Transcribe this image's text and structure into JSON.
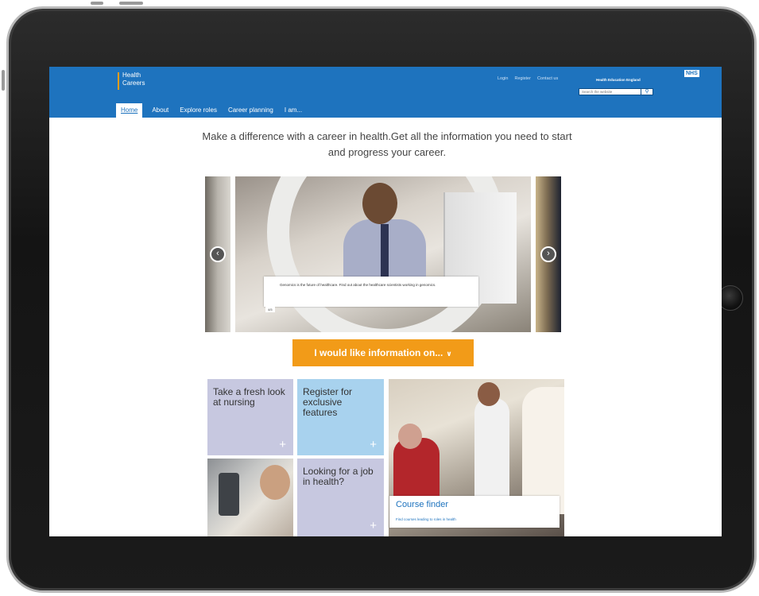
{
  "device": {
    "type": "tablet",
    "frame_color": "#1b1b1b"
  },
  "header": {
    "bg_color": "#1e73be",
    "logo": {
      "line1": "Health",
      "line2": "Careers"
    },
    "utility_links": [
      "Login",
      "Register",
      "Contact us"
    ],
    "nhs_badge": "NHS",
    "org_name": "Health Education England",
    "search": {
      "placeholder": "Search the website"
    }
  },
  "nav": {
    "items": [
      {
        "label": "Home",
        "active": true
      },
      {
        "label": "About"
      },
      {
        "label": "Explore roles"
      },
      {
        "label": "Career planning"
      },
      {
        "label": "I am..."
      }
    ]
  },
  "tagline": "Make a difference with a career in health.Get all the information you need to start and progress your career.",
  "carousel": {
    "caption": "Genomics is the future of healthcare. Find out about the healthcare scientists working in genomics.",
    "counter": "4/5",
    "prev_icon": "chevron-left-icon",
    "next_icon": "chevron-right-icon"
  },
  "cta": {
    "label": "I would like information on...",
    "icon": "chevron-down-icon",
    "color": "#f29b18"
  },
  "tiles": {
    "nursing": {
      "text": "Take a fresh look at nursing",
      "color": "#c7c8e0"
    },
    "register": {
      "text": "Register for exclusive features",
      "color": "#a8d2ee"
    },
    "job": {
      "text": "Looking for a job in health?",
      "color": "#c7c8e0"
    },
    "course": {
      "title": "Course finder",
      "desc": "Find courses leading to roles in health"
    }
  }
}
